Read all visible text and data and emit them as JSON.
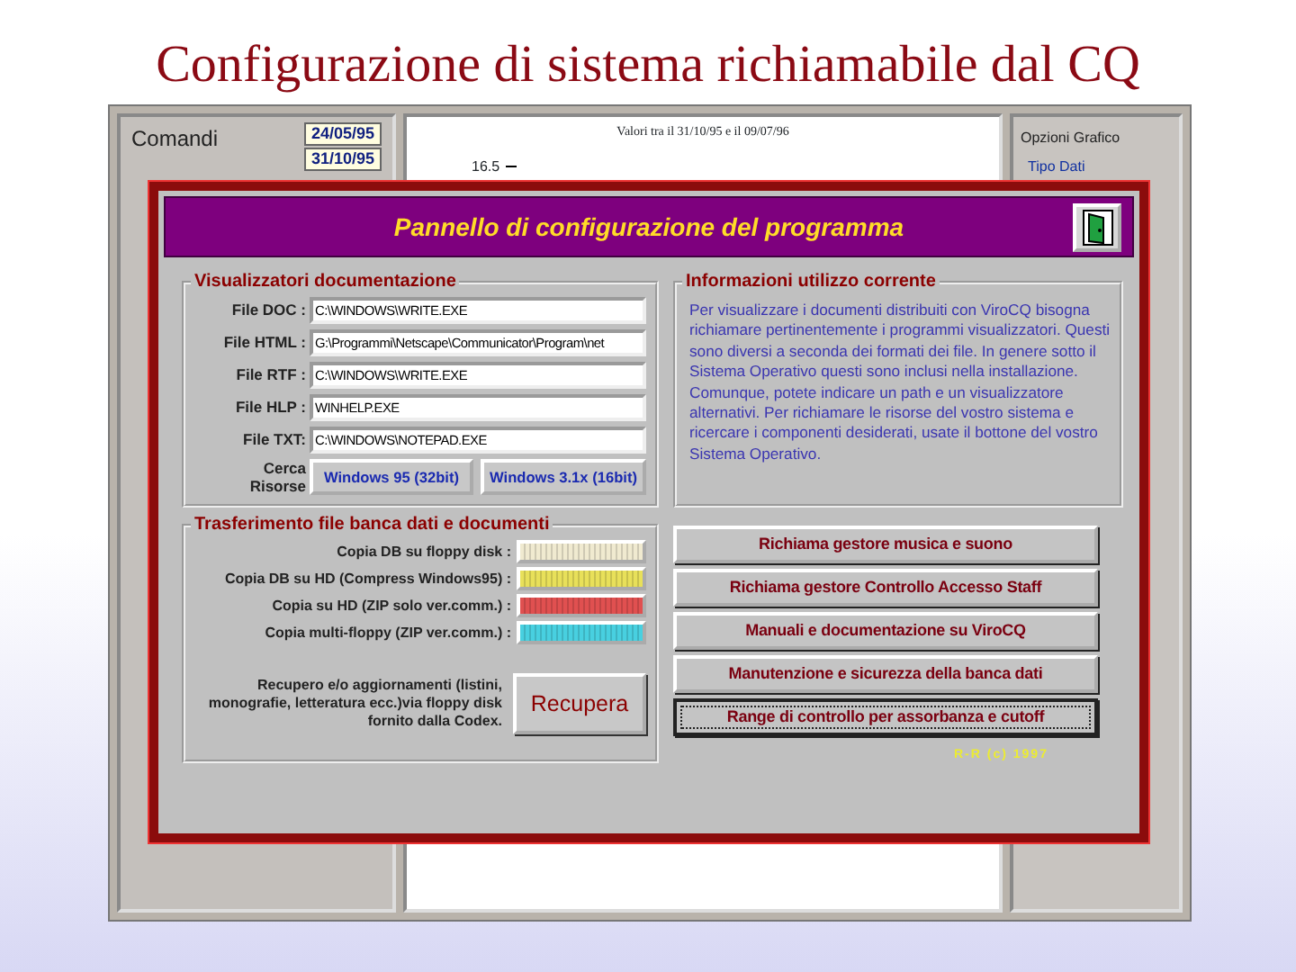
{
  "slide_title": "Configurazione di sistema richiamabile dal CQ",
  "background_app": {
    "commands_label": "Comandi",
    "date_1": "24/05/95",
    "date_2": "31/10/95",
    "chart_title": "Valori tra il 31/10/95 e il 09/07/96",
    "chart_axis_label": "16.5",
    "options_title": "Opzioni Grafico",
    "options_item": "Tipo Dati"
  },
  "dialog": {
    "title": "Pannello di configurazione del programma",
    "viewers": {
      "title": "Visualizzatori documentazione",
      "fields": [
        {
          "label": "File DOC :",
          "value": "C:\\WINDOWS\\WRITE.EXE"
        },
        {
          "label": "File HTML :",
          "value": "G:\\Programmi\\Netscape\\Communicator\\Program\\net"
        },
        {
          "label": "File RTF :",
          "value": "C:\\WINDOWS\\WRITE.EXE"
        },
        {
          "label": "File HLP :",
          "value": "WINHELP.EXE"
        },
        {
          "label": "File TXT:",
          "value": "C:\\WINDOWS\\NOTEPAD.EXE"
        }
      ],
      "search_label": "Cerca Risorse",
      "buttons": [
        "Windows 95 (32bit)",
        "Windows 3.1x (16bit)"
      ]
    },
    "info": {
      "title": "Informazioni utilizzo corrente",
      "text": "Per visualizzare i documenti distribuiti con ViroCQ bisogna richiamare pertinentemente i programmi visualizzatori. Questi sono diversi a seconda dei formati dei file. In genere sotto il Sistema Operativo questi sono inclusi nella installazione. Comunque, potete indicare un path e un visualizzatore alternativi. Per richiamare le risorse del vostro sistema e ricercare i componenti desiderati, usate il bottone del vostro Sistema Operativo."
    },
    "transfer": {
      "title": "Trasferimento file banca dati e documenti",
      "rows": [
        {
          "label": "Copia DB su floppy disk :",
          "color": "#f0ead0"
        },
        {
          "label": "Copia DB su HD  (Compress Windows95) :",
          "color": "#e8e05a"
        },
        {
          "label": "Copia su HD  (ZIP solo ver.comm.) :",
          "color": "#e05050"
        },
        {
          "label": "Copia multi-floppy (ZIP ver.comm.) :",
          "color": "#48d0e0"
        }
      ],
      "recover_text": "Recupero e/o aggiornamenti (listini, monografie, letteratura ecc.)via floppy disk fornito dalla Codex.",
      "recover_button": "Recupera"
    },
    "actions": [
      {
        "label": "Richiama gestore musica e suono",
        "focused": false
      },
      {
        "label": "Richiama gestore Controllo Accesso Staff",
        "focused": false
      },
      {
        "label": "Manuali e documentazione su ViroCQ",
        "focused": false
      },
      {
        "label": "Manutenzione e sicurezza della banca dati",
        "focused": false
      },
      {
        "label": "Range di controllo per assorbanza e cutoff",
        "focused": true
      }
    ],
    "copyright": "R-R (c) 1997"
  }
}
